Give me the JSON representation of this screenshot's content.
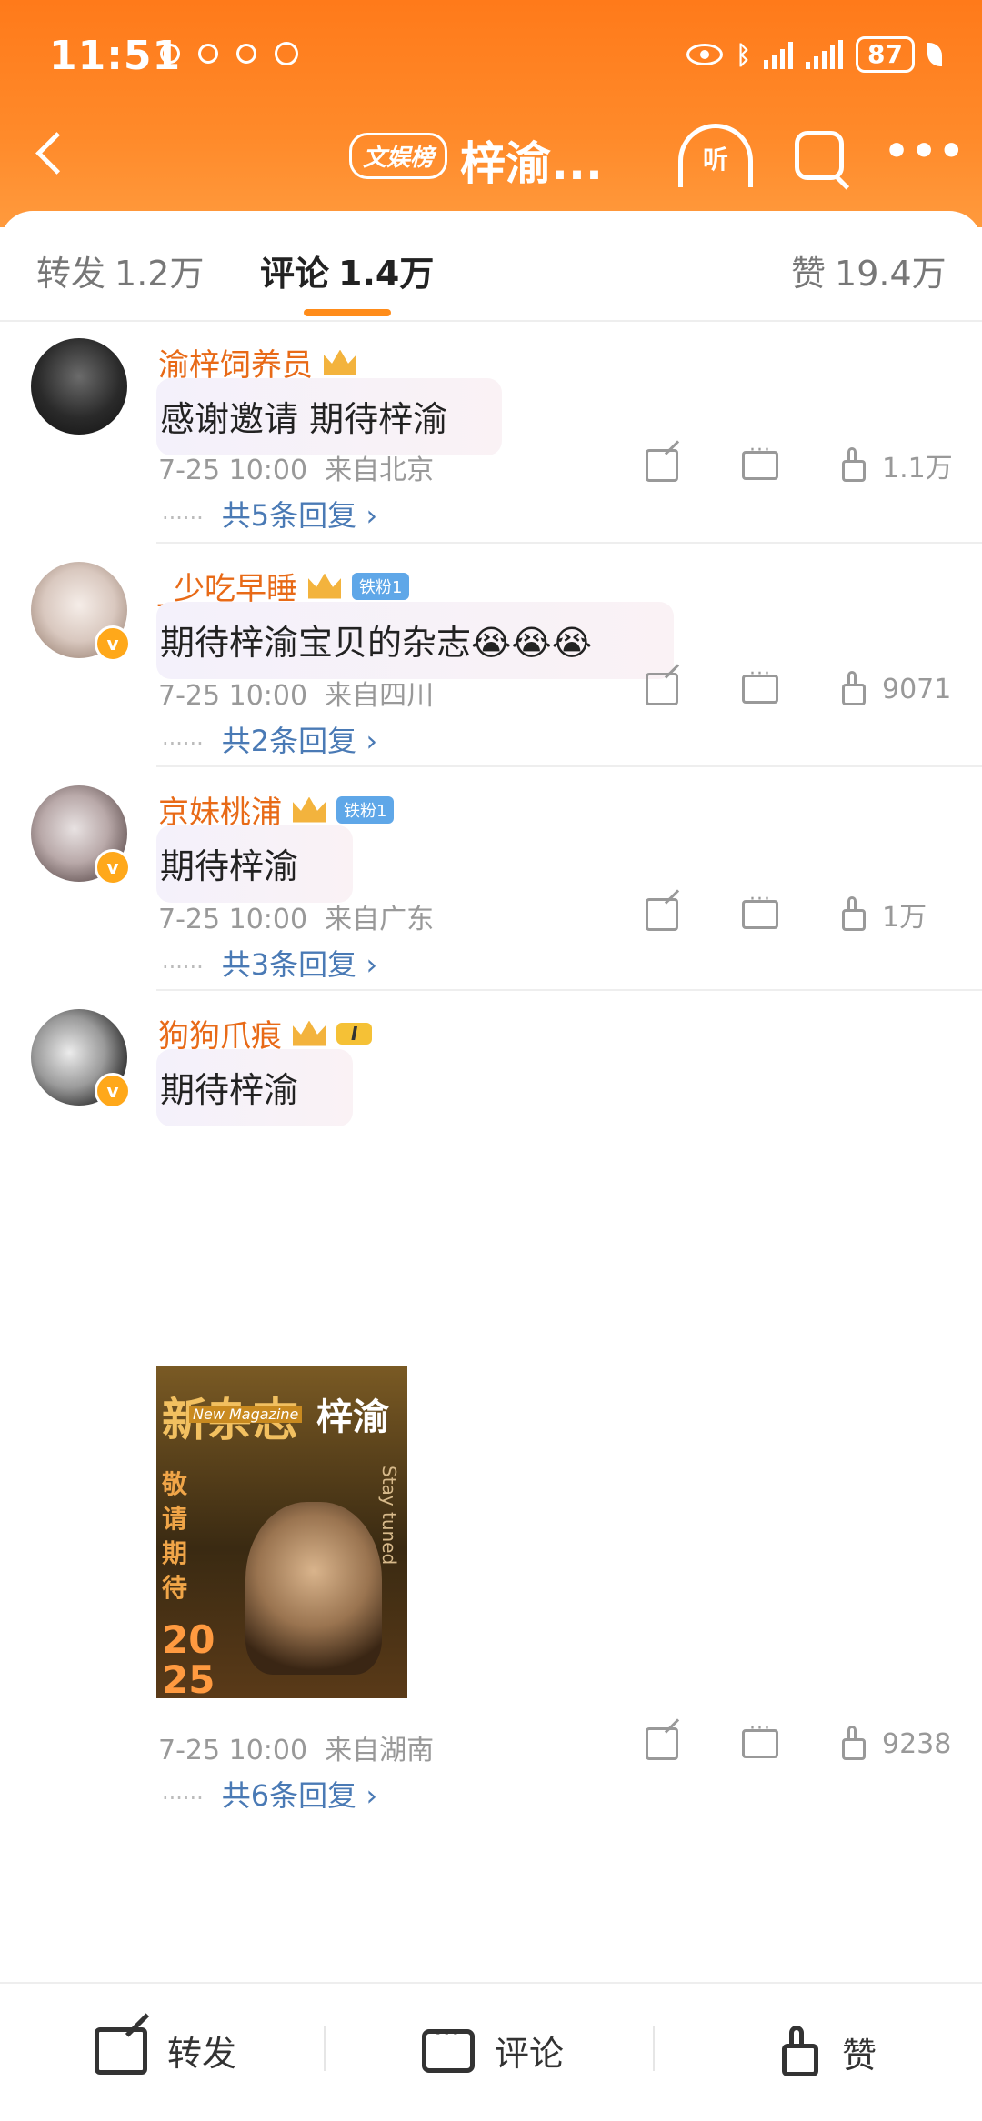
{
  "status": {
    "time": "11:51",
    "battery": "87",
    "bluetooth_icon": "bluetooth-icon"
  },
  "nav": {
    "tag": "文娱榜",
    "title": "梓渝...",
    "listen_label": "听"
  },
  "tabs": [
    {
      "label": "转发",
      "count": "1.2万"
    },
    {
      "label": "评论",
      "count": "1.4万"
    },
    {
      "label": "赞",
      "count": "19.4万"
    }
  ],
  "comments": [
    {
      "user": "渝梓饲养员",
      "text": "感谢邀请 期待梓渝",
      "time": "7-25 10:00",
      "location": "来自北京",
      "likes": "1.1万",
      "replies": "共5条回复 ›",
      "fan_badge": "",
      "level": ""
    },
    {
      "user": "_少吃早睡",
      "text": "期待梓渝宝贝的杂志😭😭😭",
      "time": "7-25 10:00",
      "location": "来自四川",
      "likes": "9071",
      "replies": "共2条回复 ›",
      "fan_badge": "铁粉1",
      "level": ""
    },
    {
      "user": "京妹桃浦",
      "text": "期待梓渝",
      "time": "7-25 10:00",
      "location": "来自广东",
      "likes": "1万",
      "replies": "共3条回复 ›",
      "fan_badge": "铁粉1",
      "level": ""
    },
    {
      "user": "狗狗爪痕",
      "text": "期待梓渝",
      "time": "7-25 10:00",
      "location": "来自湖南",
      "likes": "9238",
      "replies": "共6条回复 ›",
      "fan_badge": "",
      "level": "I"
    }
  ],
  "poster": {
    "title": "新杂志",
    "name": "梓渝",
    "tag": "New Magazine",
    "side": "敬请期待",
    "year_top": "20",
    "year_bottom": "25",
    "vertical": "Stay tuned"
  },
  "bottom": {
    "share": "转发",
    "comment": "评论",
    "like": "赞"
  },
  "colors": {
    "accent": "#ff8c1a",
    "username": "#e86a17",
    "link": "#4a7ab5"
  }
}
